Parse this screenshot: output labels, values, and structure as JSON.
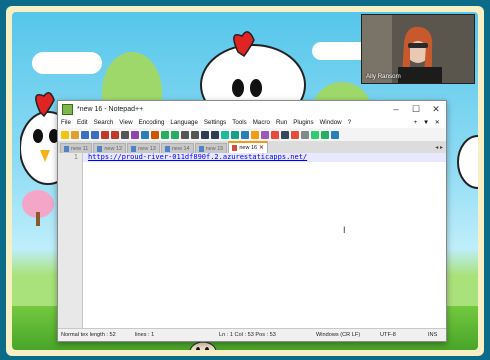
{
  "window": {
    "title": "*new 16 - Notepad++",
    "controls": [
      "–",
      "☐",
      "✕"
    ]
  },
  "menu": {
    "items": [
      "File",
      "Edit",
      "Search",
      "View",
      "Encoding",
      "Language",
      "Settings",
      "Tools",
      "Macro",
      "Run",
      "Plugins",
      "Window",
      "?"
    ],
    "right": "+ ▼ ✕"
  },
  "tabs": [
    {
      "label": "new 11",
      "active": false
    },
    {
      "label": "new 12",
      "active": false
    },
    {
      "label": "new 13",
      "active": false
    },
    {
      "label": "new 14",
      "active": false
    },
    {
      "label": "new 15",
      "active": false
    },
    {
      "label": "new 16",
      "active": true
    }
  ],
  "tab_scroll": "◂ ▸",
  "editor": {
    "line_number": "1",
    "content": "https://proud-river-011df890f.2.azurestaticapps.net/"
  },
  "status": {
    "length": "Normal tex length : 52",
    "lines": "lines : 1",
    "position": "Ln : 1   Col : 53   Pos : 53",
    "eol": "Windows (CR LF)",
    "encoding": "UTF-8",
    "mode": "INS"
  },
  "webcam": {
    "name": "Ally Ransom"
  },
  "colors": {
    "tab_accent": "#f39a1e",
    "link": "#0000ff",
    "frame": "#0b6b88"
  }
}
